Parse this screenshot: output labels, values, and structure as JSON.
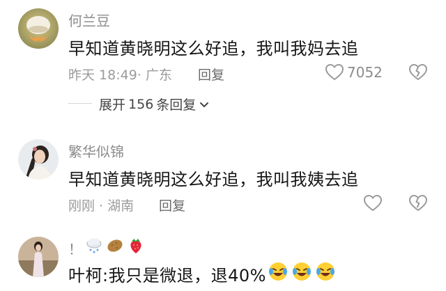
{
  "comments": [
    {
      "username": "何兰豆",
      "text": "早知道黄晓明这么好追，我叫我妈去追",
      "meta": "昨天 18:49· 广东",
      "reply_label": "回复",
      "likes": "7052",
      "avatar_icon": "jellyfish-photo-avatar",
      "expand": {
        "prefix": "展开",
        "count": "156",
        "suffix": "条回复"
      }
    },
    {
      "username": "繁华似锦",
      "text": "早知道黄晓明这么好追，我叫我姨去追",
      "meta": "刚刚 · 湖南",
      "reply_label": "回复",
      "avatar_icon": "woman-portrait-avatar"
    },
    {
      "username_prefix": "！",
      "username_icons": [
        "snow-cloud-icon",
        "potato-icon",
        "strawberry-icon"
      ],
      "text": "叶柯:我只是微退，退40%",
      "text_icons": [
        "laughing-crying-face-icon",
        "laughing-crying-face-icon",
        "laughing-crying-face-icon"
      ],
      "avatar_icon": "woman-outdoor-photo-avatar"
    }
  ],
  "colors": {
    "username": "#8c8c8c",
    "body": "#161616",
    "meta": "#9b9b9b",
    "icon": "#9a9a9a"
  }
}
